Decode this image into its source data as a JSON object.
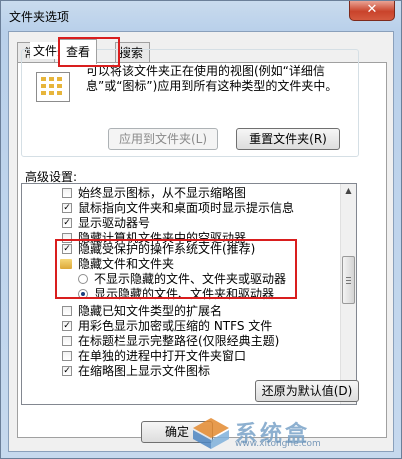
{
  "window": {
    "title": "文件夹选项",
    "close_glyph": "✕"
  },
  "tabs": [
    {
      "label": "常规"
    },
    {
      "label": "查看"
    },
    {
      "label": "搜索"
    }
  ],
  "folder_views": {
    "title": "文件夹视图",
    "description": "可以将该文件夹正在使用的视图(例如“详细信息”或“图标”)应用到所有这种类型的文件夹中。",
    "apply_button": "应用到文件夹(L)",
    "reset_button": "重置文件夹(R)"
  },
  "advanced": {
    "label": "高级设置:",
    "items": [
      {
        "type": "checkbox",
        "checked": false,
        "text": "始终显示图标，从不显示缩略图"
      },
      {
        "type": "checkbox",
        "checked": true,
        "text": "鼠标指向文件夹和桌面项时显示提示信息"
      },
      {
        "type": "checkbox",
        "checked": true,
        "text": "显示驱动器号"
      },
      {
        "type": "checkbox",
        "checked": false,
        "text": "隐藏计算机文件夹中的空驱动器"
      },
      {
        "type": "checkbox",
        "checked": true,
        "text": "隐藏受保护的操作系统文件(推荐)"
      },
      {
        "type": "folder",
        "text": "隐藏文件和文件夹"
      },
      {
        "type": "radio",
        "checked": false,
        "text": "不显示隐藏的文件、文件夹或驱动器"
      },
      {
        "type": "radio",
        "checked": true,
        "text": "显示隐藏的文件、文件夹和驱动器"
      },
      {
        "type": "checkbox",
        "checked": false,
        "text": "隐藏已知文件类型的扩展名"
      },
      {
        "type": "checkbox",
        "checked": true,
        "text": "用彩色显示加密或压缩的 NTFS 文件"
      },
      {
        "type": "checkbox",
        "checked": false,
        "text": "在标题栏显示完整路径(仅限经典主题)"
      },
      {
        "type": "checkbox",
        "checked": false,
        "text": "在单独的进程中打开文件夹窗口"
      },
      {
        "type": "checkbox",
        "checked": true,
        "text": "在缩略图上显示文件图标"
      }
    ],
    "restore_button": "还原为默认值(D)"
  },
  "footer": {
    "ok_button": "确定"
  },
  "watermark": {
    "text": "系统盒",
    "url": "www.xitonghe.com"
  },
  "colors": {
    "highlight": "#d91e1e",
    "accent": "#3b7dd8"
  }
}
